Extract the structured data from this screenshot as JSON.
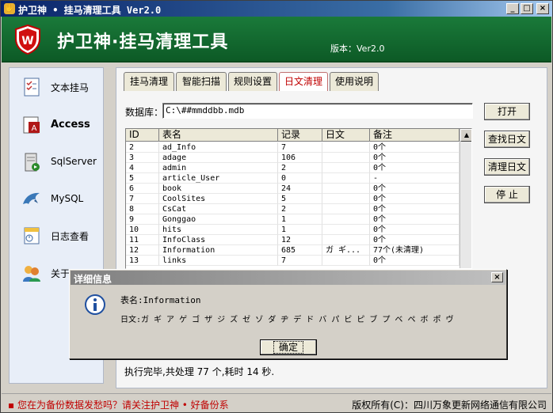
{
  "window": {
    "title": "护卫神 • 挂马清理工具 Ver2.0",
    "min": "_",
    "max": "□",
    "close": "×"
  },
  "banner": {
    "title": "护卫神·挂马清理工具",
    "version": "版本：Ver2.0"
  },
  "sidebar": {
    "items": [
      {
        "label": "文本挂马",
        "icon": "document-checklist-icon"
      },
      {
        "label": "Access",
        "icon": "access-database-icon"
      },
      {
        "label": "SqlServer",
        "icon": "sqlserver-icon"
      },
      {
        "label": "MySQL",
        "icon": "mysql-dolphin-icon"
      },
      {
        "label": "日志查看",
        "icon": "log-icon"
      },
      {
        "label": "关于",
        "icon": "users-icon"
      }
    ]
  },
  "tabs": [
    "挂马清理",
    "智能扫描",
    "规则设置",
    "日文清理",
    "使用说明"
  ],
  "database": {
    "label": "数据库：",
    "value": "C:\\##mmddbb.mdb"
  },
  "buttons": {
    "open": "打开",
    "find": "查找日文",
    "clean": "清理日文",
    "stop": "停 止"
  },
  "grid": {
    "headers": [
      "ID",
      "表名",
      "记录",
      "日文",
      "备注"
    ],
    "rows": [
      [
        "2",
        "ad_Info",
        "7",
        "",
        "0个"
      ],
      [
        "3",
        "adage",
        "106",
        "",
        "0个"
      ],
      [
        "4",
        "admin",
        "2",
        "",
        "0个"
      ],
      [
        "5",
        "article_User",
        "0",
        "",
        "-"
      ],
      [
        "6",
        "book",
        "24",
        "",
        "0个"
      ],
      [
        "7",
        "CoolSites",
        "5",
        "",
        "0个"
      ],
      [
        "8",
        "CsCat",
        "2",
        "",
        "0个"
      ],
      [
        "9",
        "Gonggao",
        "1",
        "",
        "0个"
      ],
      [
        "10",
        "hits",
        "1",
        "",
        "0个"
      ],
      [
        "11",
        "InfoClass",
        "12",
        "",
        "0个"
      ],
      [
        "12",
        "Information",
        "685",
        "ガ ギ...",
        "77个(未清理)"
      ],
      [
        "13",
        "links",
        "7",
        "",
        "0个"
      ]
    ]
  },
  "status": "执行完毕,共处理 77 个,耗时 14 秒.",
  "footer": {
    "left": "您在为备份数据发愁吗？请关注护卫神 • 好备份系",
    "right": "版权所有(C)：四川万象更新网络通信有限公司"
  },
  "dialog": {
    "title": "详细信息",
    "close": "×",
    "line1": "表名:Information",
    "line2": "日文:ガ ギ ア ゲ ゴ ザ ジ ズ ゼ ゾ ダ ヂ デ ド バ パ ビ ピ ブ プ ベ ペ ボ ポ ヴ",
    "ok": "确定"
  },
  "colors": {
    "banner": "#1a7a3a",
    "active_tab": "#c00000",
    "footer_promo": "#c00000"
  }
}
